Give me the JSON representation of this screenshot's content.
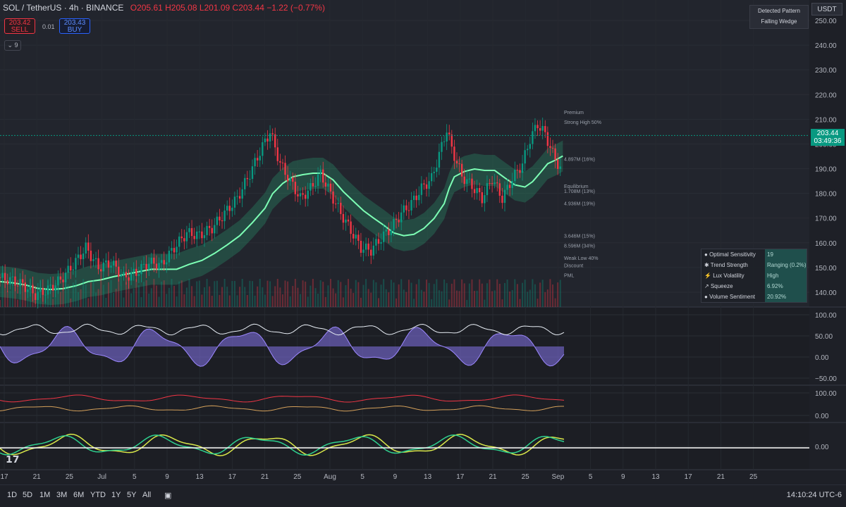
{
  "header": {
    "symbol": "SOL / TetherUS · 4h · BINANCE",
    "ohlc": "O205.61 H205.08 L201.09 C203.44 −1.22 (−0.77%)"
  },
  "trade": {
    "sell_price": "203.42",
    "sell_label": "SELL",
    "spread": "0.01",
    "buy_price": "203.43",
    "buy_label": "BUY"
  },
  "indicators_toggle": "9",
  "pattern_box": {
    "title": "Detected Pattern",
    "value": "Falling Wedge"
  },
  "currency_button": "USDT",
  "last_price": {
    "price": "203.44",
    "countdown": "03:49:36"
  },
  "dashboard": [
    {
      "label": "Optimal Sensitivity",
      "value": "19"
    },
    {
      "label": "Trend Strength",
      "value": "Ranging (0.2%)"
    },
    {
      "label": "Lux Volatility",
      "value": "High"
    },
    {
      "label": "Squeeze",
      "value": "6.92%"
    },
    {
      "label": "Volume Sentiment",
      "value": "20.92%"
    }
  ],
  "toolbar": {
    "timeframes": [
      "1D",
      "5D",
      "1M",
      "3M",
      "6M",
      "YTD",
      "1Y",
      "5Y",
      "All"
    ],
    "clock": "14:10:24 UTC-6"
  },
  "colors": {
    "bg": "#1e2027",
    "up": "#089981",
    "down": "#f23645",
    "band_green": "#2fd18f",
    "band_red": "#e0435f"
  },
  "chart_data": {
    "type": "candlestick",
    "y_ticks": [
      140,
      150,
      160,
      170,
      180,
      190,
      200,
      210,
      220,
      230,
      240,
      250
    ],
    "ylim": [
      134,
      252
    ],
    "x_ticks": [
      "17",
      "21",
      "25",
      "Jul",
      "5",
      "9",
      "13",
      "17",
      "21",
      "25",
      "Aug",
      "5",
      "9",
      "13",
      "17",
      "21",
      "25",
      "Sep",
      "5",
      "9",
      "13",
      "17",
      "21",
      "25"
    ],
    "close_path": [
      [
        0,
        146
      ],
      [
        5,
        145
      ],
      [
        10,
        143
      ],
      [
        15,
        139
      ],
      [
        20,
        141
      ],
      [
        25,
        145
      ],
      [
        30,
        151
      ],
      [
        35,
        158
      ],
      [
        40,
        150
      ],
      [
        45,
        152
      ],
      [
        50,
        146
      ],
      [
        55,
        148
      ],
      [
        60,
        152
      ],
      [
        65,
        151
      ],
      [
        70,
        158
      ],
      [
        75,
        164
      ],
      [
        80,
        163
      ],
      [
        85,
        166
      ],
      [
        90,
        172
      ],
      [
        95,
        178
      ],
      [
        100,
        188
      ],
      [
        105,
        199
      ],
      [
        108,
        205
      ],
      [
        112,
        192
      ],
      [
        116,
        185
      ],
      [
        120,
        178
      ],
      [
        124,
        182
      ],
      [
        128,
        188
      ],
      [
        132,
        180
      ],
      [
        136,
        172
      ],
      [
        140,
        165
      ],
      [
        144,
        158
      ],
      [
        148,
        157
      ],
      [
        152,
        162
      ],
      [
        156,
        166
      ],
      [
        160,
        172
      ],
      [
        164,
        176
      ],
      [
        168,
        182
      ],
      [
        172,
        186
      ],
      [
        176,
        199
      ],
      [
        178,
        206
      ],
      [
        180,
        198
      ],
      [
        184,
        187
      ],
      [
        188,
        183
      ],
      [
        192,
        178
      ],
      [
        196,
        186
      ],
      [
        200,
        178
      ],
      [
        204,
        186
      ],
      [
        208,
        192
      ],
      [
        211,
        202
      ],
      [
        214,
        208
      ],
      [
        217,
        204
      ],
      [
        220,
        196
      ],
      [
        223,
        190
      ]
    ],
    "price_labels": [
      {
        "text": "Premium",
        "y": 213
      },
      {
        "text": "Strong High 50%",
        "y": 209
      },
      {
        "text": "4.897M (16%)",
        "y": 194
      },
      {
        "text": "Equilibrium",
        "y": 183
      },
      {
        "text": "1.708M (13%)",
        "y": 181
      },
      {
        "text": "4.936M (19%)",
        "y": 176
      },
      {
        "text": "3.646M (15%)",
        "y": 163
      },
      {
        "text": "8.596M (34%)",
        "y": 159
      },
      {
        "text": "Weak Low 40%",
        "y": 154
      },
      {
        "text": "Discount",
        "y": 151
      },
      {
        "text": "PML",
        "y": 147
      }
    ],
    "osc1_ticks": [
      "100.00",
      "50.00",
      "0.00",
      "−50.00"
    ],
    "osc2_ticks": [
      "100.00",
      "0.00"
    ],
    "osc3_ticks": [
      "0.00"
    ]
  }
}
